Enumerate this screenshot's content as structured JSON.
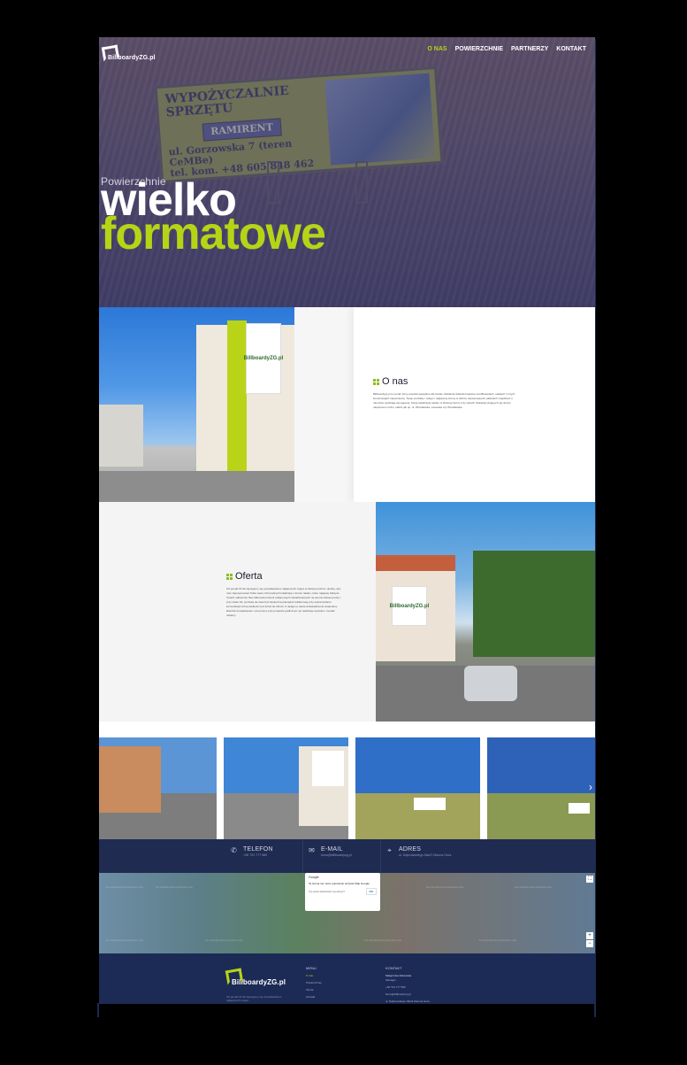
{
  "brand": {
    "name": "BillboardyZG.pl"
  },
  "nav": {
    "items": [
      "O NAS",
      "POWIERZCHNIE",
      "PARTNERZY",
      "KONTAKT"
    ]
  },
  "hero": {
    "pretitle": "Powierzchnie",
    "title_line1": "wielko",
    "title_line2": "formatowe",
    "billboard": {
      "line1": "WYPOŻYCZALNIE SPRZĘTU",
      "line2": "RAMIRENT",
      "line3": "ul. Gorzowska 7 (teren CeMBe)",
      "line4": "tel. kom. +48 605 848 462"
    }
  },
  "about": {
    "title": "O nas",
    "body": "Billboardyzg.pl to portal, który powstał specjalnie dla Ciebie. Reklama wielkoformatowa na billboardach, siatkach i innych konstrukcjach zapewniamy. Twoje produkty i usługi z najlepszej strony w dobrze dopasowanych pakietach znajdziesz u nas które spełniają wymagania. Twoja lokalizacja reklam w Zielonej Górze przy ulicach charakteryzujących się dużym natężeniem ruchu, takich jak np. ul. Wrocławska, Lwowska czy Wrocławska."
  },
  "offer": {
    "title": "Oferta",
    "body": "Od ponad 15 lat zajmujemy się pozyskiwaniem najlepszych miejsc w Zielonej Górze i okolicy, aby móc zaproponować Tobie wiele różnorodnych lokalizacji o formie reklam, które najlepiej trafią do Twoich odbiorców. Bez kilkunastu historii reklamowych zlokalizowanych na terenie Zielonej Góry i przy trasie S3, pozwolą nie stworzyć skutecznej kampanii reklamowej przy wykorzystaniu komunikacji różnej wielkości (od 12m2 do 24m2). Z uwagi na nasze doświadczenie wspieramy klientów kompleksowo: od pomocy przy projekcie graficznym po realizacje wydruku i montaż reklamy."
  },
  "contact": {
    "phone": {
      "label": "TELEFON",
      "value": "+48 791 777 580"
    },
    "email": {
      "label": "E-MAIL",
      "value": "biuro@billboardyzg.pl"
    },
    "address": {
      "label": "ADRES",
      "value": "ul. Dąbrowskiego 46a/3 Zielona Góra"
    }
  },
  "map": {
    "watermark": "For development purposes only",
    "dialog_brand": "Google",
    "dialog_message": "Ta strona nie może poprawnie wczytać Map Google.",
    "dialog_detail": "Czy jesteś właścicielem tej witryny?",
    "ok_label": "OK",
    "zoom_in": "+",
    "zoom_out": "−"
  },
  "footer": {
    "menu_heading": "MENU",
    "menu_items": [
      "O nas",
      "Powierzchnie",
      "Oferta",
      "Kontakt"
    ],
    "contact_heading": "KONTAKT",
    "contact_name": "Małgorzata Zakowska",
    "contact_role": "Manager",
    "contact_lines": [
      "+48 791 777 580",
      "biuro@billboardyzg.pl",
      "ul. Dąbrowskiego 46a/3 Zielona Góra"
    ],
    "desc": "Od ponad 15 lat zajmujemy się pozyskiwaniem najlepszych miejsc..."
  },
  "colors": {
    "accent": "#b6d416",
    "navy": "#1f2b51",
    "hero_overlay": "#4e4866"
  }
}
